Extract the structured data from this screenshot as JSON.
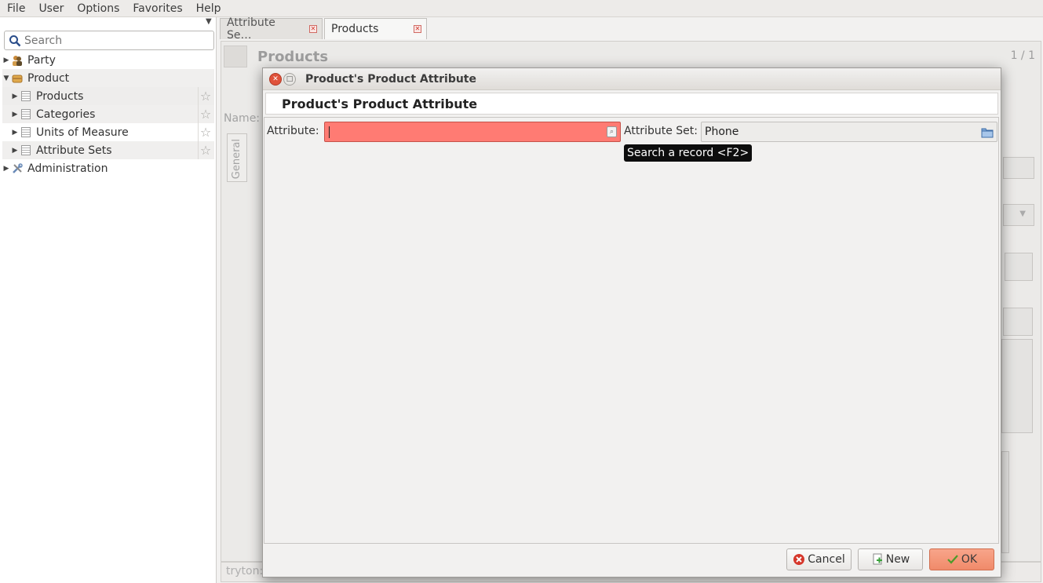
{
  "menubar": {
    "items": [
      "File",
      "User",
      "Options",
      "Favorites",
      "Help"
    ]
  },
  "sidebar": {
    "search_placeholder": "Search",
    "items": [
      {
        "label": "Party",
        "level": 0,
        "expanded": false
      },
      {
        "label": "Product",
        "level": 0,
        "expanded": true
      },
      {
        "label": "Products",
        "level": 1
      },
      {
        "label": "Categories",
        "level": 1
      },
      {
        "label": "Units of Measure",
        "level": 1
      },
      {
        "label": "Attribute Sets",
        "level": 1
      },
      {
        "label": "Administration",
        "level": 0,
        "expanded": false
      }
    ]
  },
  "tabs": [
    {
      "label": "Attribute Se…",
      "active": false
    },
    {
      "label": "Products",
      "active": true
    }
  ],
  "background": {
    "title": "Products",
    "pager": "1 / 1",
    "name_label": "Name:",
    "tab_general": "General",
    "status_text": "tryton:"
  },
  "dialog": {
    "window_title": "Product's Product Attribute",
    "header": "Product's Product Attribute",
    "attribute_label": "Attribute:",
    "attribute_value": "",
    "attribute_set_label": "Attribute Set:",
    "attribute_set_value": "Phone",
    "tooltip": "Search a record <F2>",
    "buttons": {
      "cancel": "Cancel",
      "new": "New",
      "ok": "OK"
    },
    "colors": {
      "required_field": "#ff7b73",
      "ok_button": "#f08a6a"
    }
  }
}
